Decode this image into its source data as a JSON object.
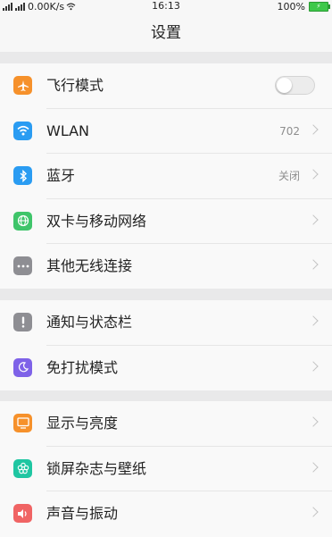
{
  "status_bar": {
    "network_speed": "0.00K/s",
    "time": "16:13",
    "battery": "100%"
  },
  "header": {
    "title": "设置"
  },
  "groups": [
    {
      "items": [
        {
          "label": "飞行模式",
          "control": "toggle",
          "toggle_on": false,
          "icon": "airplane-icon",
          "icon_color": "#f6912b"
        },
        {
          "label": "WLAN",
          "value": "702",
          "icon": "wifi-icon",
          "icon_color": "#2a9cf2"
        },
        {
          "label": "蓝牙",
          "value": "关闭",
          "icon": "bluetooth-icon",
          "icon_color": "#2a9cf2"
        },
        {
          "label": "双卡与移动网络",
          "icon": "globe-icon",
          "icon_color": "#3fc56a"
        },
        {
          "label": "其他无线连接",
          "icon": "more-dots-icon",
          "icon_color": "#8e8e93"
        }
      ]
    },
    {
      "items": [
        {
          "label": "通知与状态栏",
          "icon": "notification-icon",
          "icon_color": "#8e8e93"
        },
        {
          "label": "免打扰模式",
          "icon": "moon-icon",
          "icon_color": "#7e62e8"
        }
      ]
    },
    {
      "items": [
        {
          "label": "显示与亮度",
          "icon": "display-icon",
          "icon_color": "#f6912b"
        },
        {
          "label": "锁屏杂志与壁纸",
          "icon": "flower-icon",
          "icon_color": "#1fc6a2"
        },
        {
          "label": "声音与振动",
          "icon": "sound-icon",
          "icon_color": "#f06464"
        }
      ]
    }
  ]
}
